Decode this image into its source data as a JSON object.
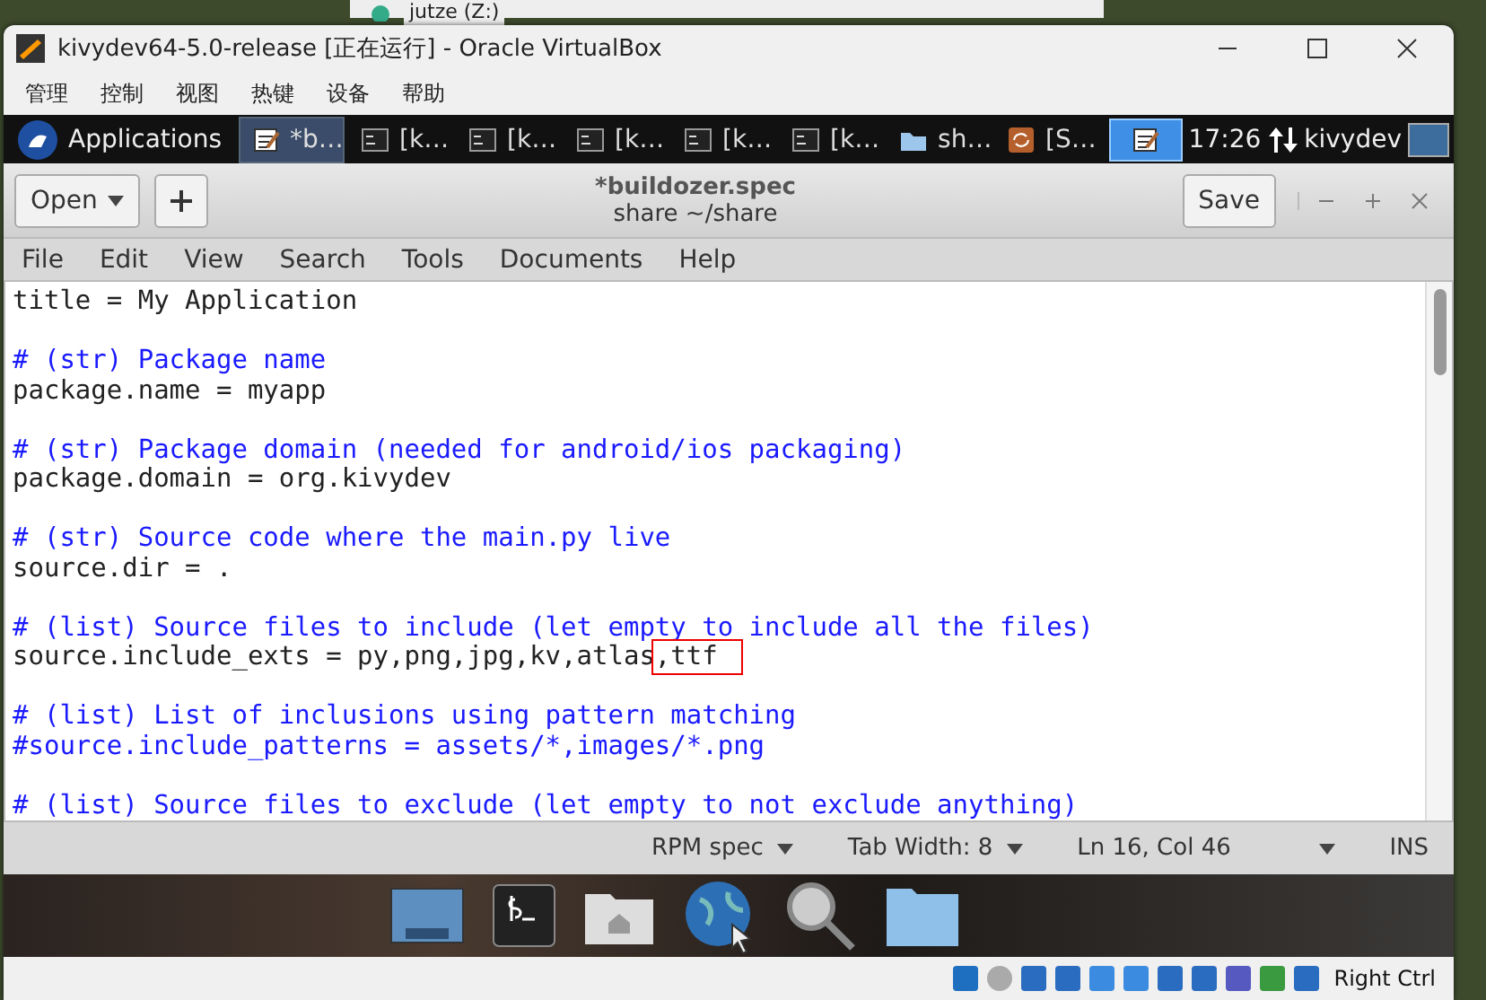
{
  "background_window": {
    "item": "jutze (Z:)"
  },
  "window": {
    "title": "kivydev64-5.0-release [正在运行] - Oracle VirtualBox",
    "menu": [
      "管理",
      "控制",
      "视图",
      "热键",
      "设备",
      "帮助"
    ]
  },
  "guest_panel": {
    "menu_label": "Applications",
    "tasks": [
      {
        "label": "*b…",
        "kind": "editor",
        "selected": true
      },
      {
        "label": "[k…",
        "kind": "terminal",
        "selected": false
      },
      {
        "label": "[k…",
        "kind": "terminal",
        "selected": false
      },
      {
        "label": "[k…",
        "kind": "terminal",
        "selected": false
      },
      {
        "label": "[k…",
        "kind": "terminal",
        "selected": false
      },
      {
        "label": "[k…",
        "kind": "terminal",
        "selected": false
      },
      {
        "label": "sh…",
        "kind": "folder",
        "selected": false
      },
      {
        "label": "[S…",
        "kind": "sync",
        "selected": false
      }
    ],
    "clock": "17:26",
    "user": "kivydev"
  },
  "editor": {
    "open_button": "Open",
    "title": "*buildozer.spec",
    "subtitle": "share ~/share",
    "save_button": "Save",
    "menu": [
      "File",
      "Edit",
      "View",
      "Search",
      "Tools",
      "Documents",
      "Help"
    ],
    "lines": [
      {
        "kind": "code",
        "text": "title = My Application"
      },
      {
        "kind": "blank"
      },
      {
        "kind": "comment",
        "text": "# (str) Package name"
      },
      {
        "kind": "code",
        "text": "package.name = myapp"
      },
      {
        "kind": "blank"
      },
      {
        "kind": "comment",
        "text": "# (str) Package domain (needed for android/ios packaging)"
      },
      {
        "kind": "code",
        "text": "package.domain = org.kivydev"
      },
      {
        "kind": "blank"
      },
      {
        "kind": "comment",
        "text": "# (str) Source code where the main.py live"
      },
      {
        "kind": "code",
        "text": "source.dir = ."
      },
      {
        "kind": "blank"
      },
      {
        "kind": "comment",
        "text": "# (list) Source files to include (let empty to include all the files)"
      },
      {
        "kind": "code",
        "text": "source.include_exts = py,png,jpg,kv,atlas",
        "marked": ",ttf"
      },
      {
        "kind": "blank"
      },
      {
        "kind": "comment",
        "text": "# (list) List of inclusions using pattern matching"
      },
      {
        "kind": "comment",
        "text": "#source.include_patterns = assets/*,images/*.png"
      },
      {
        "kind": "blank"
      },
      {
        "kind": "comment",
        "text": "# (list) Source files to exclude (let empty to not exclude anything)"
      }
    ],
    "status": {
      "language": "RPM spec",
      "tab_width": "Tab Width: 8",
      "position": "Ln 16, Col 46",
      "mode": "INS"
    }
  },
  "vbox_status": {
    "host_key": "Right Ctrl"
  }
}
